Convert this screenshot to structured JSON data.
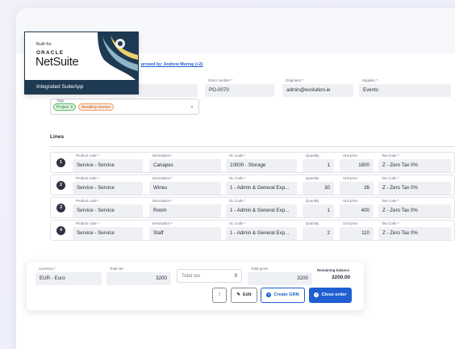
{
  "badge": {
    "built_for": "Built for",
    "oracle": "ORACLE",
    "netsuite": "NetSuite",
    "footer": "Integrated SuiteApp"
  },
  "header": {
    "approved_by": "proved by: Andrew Murray (+2)"
  },
  "order": {
    "order_number_label": "Order number *",
    "order_number": "PO-0070",
    "originator_label": "Originator *",
    "originator": "admin@evolution.ie",
    "supplier_label": "Supplier *",
    "supplier": "Events"
  },
  "tags": {
    "label": "Tags",
    "items": [
      "Project X",
      "Awaiting Invoice"
    ]
  },
  "lines": {
    "title": "Lines",
    "col_labels": {
      "product": "Product code *",
      "description": "Description *",
      "gl": "GL Code *",
      "quantity": "Quantity",
      "unit_price": "Unit price",
      "tax": "Tax Code *"
    },
    "rows": [
      {
        "num": "1",
        "product": "Service - Service",
        "description": "Canapes",
        "gl": "10000 - Storage",
        "quantity": "1",
        "unit_price": "1800",
        "tax": "Z - Zero Tax 0%"
      },
      {
        "num": "2",
        "product": "Service - Service",
        "description": "Wines",
        "gl": "1 - Admin & General Exp...",
        "quantity": "30",
        "unit_price": "26",
        "tax": "Z - Zero Tax 0%"
      },
      {
        "num": "3",
        "product": "Service - Service",
        "description": "Room",
        "gl": "1 - Admin & General Exp...",
        "quantity": "1",
        "unit_price": "400",
        "tax": "Z - Zero Tax 0%"
      },
      {
        "num": "4",
        "product": "Service - Service",
        "description": "Staff",
        "gl": "1 - Admin & General Exp...",
        "quantity": "2",
        "unit_price": "110",
        "tax": "Z - Zero Tax 0%"
      }
    ]
  },
  "totals": {
    "currency_label": "Currency *",
    "currency": "EUR - Euro",
    "total_net_label": "Total net",
    "total_net": "3200",
    "total_tax_label": "Total tax",
    "total_tax": "0",
    "total_gross_label": "Total gross",
    "total_gross": "3200",
    "remaining_label": "Remaining balance",
    "remaining": "3200.00"
  },
  "actions": {
    "more": "⋮",
    "edit": "Edit",
    "create_grn": "Create GRN",
    "close_order": "Close order"
  },
  "colors": {
    "accent": "#1f5fd1",
    "badge_navy": "#1e3a52",
    "tag_green": "#54b866",
    "tag_orange": "#ef9a63"
  }
}
